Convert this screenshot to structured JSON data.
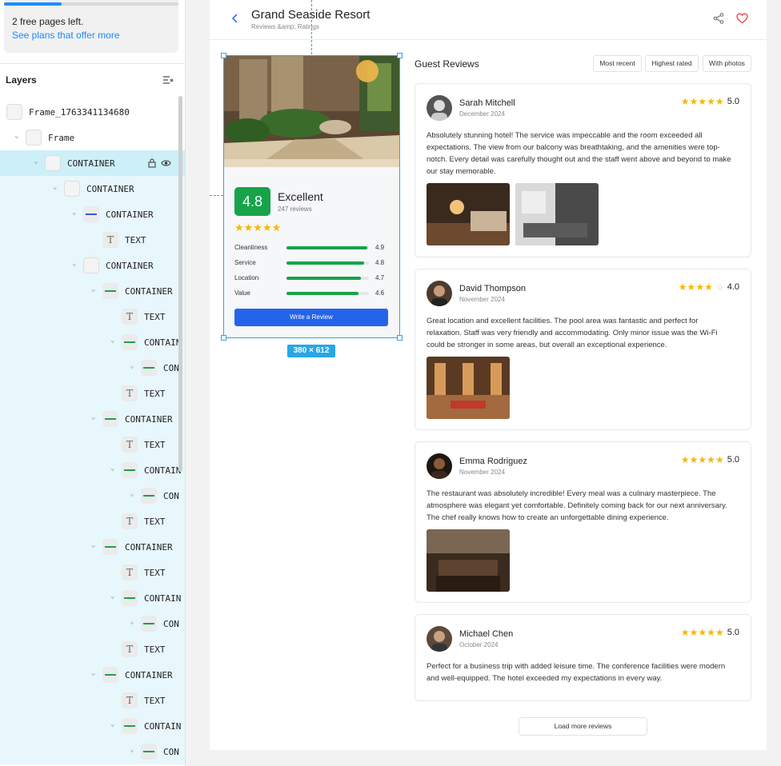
{
  "plan": {
    "progress_fraction": 0.33,
    "pages_left_text": "2 free pages left.",
    "link_text": "See plans that offer more"
  },
  "layers": {
    "title": "Layers",
    "rows": [
      {
        "label": "Frame_1763341134680",
        "depth": 0,
        "kind": "frame"
      },
      {
        "label": "Frame",
        "depth": 1,
        "kind": "frame"
      },
      {
        "label": "CONTAINER",
        "depth": 2,
        "kind": "container",
        "selected": true
      },
      {
        "label": "CONTAINER",
        "depth": 3,
        "kind": "container"
      },
      {
        "label": "CONTAINER",
        "depth": 4,
        "kind": "container-blue"
      },
      {
        "label": "TEXT",
        "depth": 5,
        "kind": "text"
      },
      {
        "label": "CONTAINER",
        "depth": 4,
        "kind": "container"
      },
      {
        "label": "CONTAINER",
        "depth": 5,
        "kind": "container-green"
      },
      {
        "label": "TEXT",
        "depth": 6,
        "kind": "text"
      },
      {
        "label": "CONTAIN",
        "depth": 6,
        "kind": "container-green"
      },
      {
        "label": "CON",
        "depth": 7,
        "kind": "container-green"
      },
      {
        "label": "TEXT",
        "depth": 6,
        "kind": "text"
      },
      {
        "label": "CONTAINER",
        "depth": 5,
        "kind": "container-green"
      },
      {
        "label": "TEXT",
        "depth": 6,
        "kind": "text"
      },
      {
        "label": "CONTAIN",
        "depth": 6,
        "kind": "container-green"
      },
      {
        "label": "CON",
        "depth": 7,
        "kind": "container-green"
      },
      {
        "label": "TEXT",
        "depth": 6,
        "kind": "text"
      },
      {
        "label": "CONTAINER",
        "depth": 5,
        "kind": "container-green"
      },
      {
        "label": "TEXT",
        "depth": 6,
        "kind": "text"
      },
      {
        "label": "CONTAIN",
        "depth": 6,
        "kind": "container-green"
      },
      {
        "label": "CON",
        "depth": 7,
        "kind": "container-green"
      },
      {
        "label": "TEXT",
        "depth": 6,
        "kind": "text"
      },
      {
        "label": "CONTAINER",
        "depth": 5,
        "kind": "container-green"
      },
      {
        "label": "TEXT",
        "depth": 6,
        "kind": "text"
      },
      {
        "label": "CONTAIN",
        "depth": 6,
        "kind": "container-green"
      },
      {
        "label": "CON",
        "depth": 7,
        "kind": "container-green"
      }
    ]
  },
  "header": {
    "title": "Grand Seaside Resort",
    "subtitle": "Reviews &amp; Ratings",
    "back_icon": "chevron-left-icon",
    "share_icon": "share-icon",
    "favorite_icon": "heart-icon"
  },
  "selection": {
    "dimensions_label": "380 × 612"
  },
  "summary": {
    "score": "4.8",
    "score_label": "Excellent",
    "review_count": "247 reviews",
    "stars": "★★★★★",
    "metrics": [
      {
        "name": "Cleanliness",
        "value": "4.9",
        "fraction": 0.98
      },
      {
        "name": "Service",
        "value": "4.8",
        "fraction": 0.94
      },
      {
        "name": "Location",
        "value": "4.7",
        "fraction": 0.9
      },
      {
        "name": "Value",
        "value": "4.6",
        "fraction": 0.87
      }
    ],
    "write_button": "Write a Review"
  },
  "reviews_section": {
    "title": "Guest Reviews",
    "filters": [
      "Most recent",
      "Highest rated",
      "With photos"
    ],
    "load_more": "Load more reviews"
  },
  "reviews": [
    {
      "name": "Sarah Mitchell",
      "date": "December 2024",
      "stars": "★★★★★",
      "empty_stars": "",
      "rating": "5.0",
      "text": "Absolutely stunning hotel! The service was impeccable and the room exceeded all expectations. The view from our balcony was breathtaking, and the amenities were top-notch. Every detail was carefully thought out and the staff went above and beyond to make our stay memorable."
    },
    {
      "name": "David Thompson",
      "date": "November 2024",
      "stars": "★★★★",
      "empty_stars": "☆",
      "rating": "4.0",
      "text": "Great location and excellent facilities. The pool area was fantastic and perfect for relaxation. Staff was very friendly and accommodating. Only minor issue was the Wi-Fi could be stronger in some areas, but overall an exceptional experience."
    },
    {
      "name": "Emma Rodriguez",
      "date": "November 2024",
      "stars": "★★★★★",
      "empty_stars": "",
      "rating": "5.0",
      "text": "The restaurant was absolutely incredible! Every meal was a culinary masterpiece. The atmosphere was elegant yet comfortable. Definitely coming back for our next anniversary. The chef really knows how to create an unforgettable dining experience."
    },
    {
      "name": "Michael Chen",
      "date": "October 2024",
      "stars": "★★★★★",
      "empty_stars": "",
      "rating": "5.0",
      "text": "Perfect for a business trip with added leisure time. The conference facilities were modern and well-equipped. The hotel exceeded my expectations in every way."
    }
  ]
}
